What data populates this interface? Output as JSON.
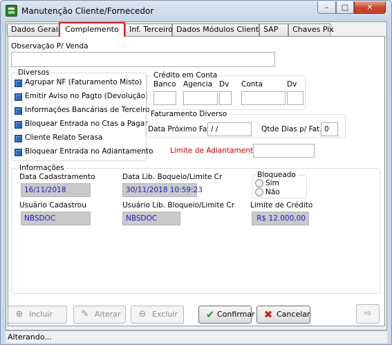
{
  "window": {
    "title": "Manutenção Cliente/Fornecedor",
    "minimize": "–",
    "maximize": "□",
    "close": "✕"
  },
  "tabs": [
    {
      "label": "Dados Gerais",
      "active": false
    },
    {
      "label": "Complemento",
      "active": true
    },
    {
      "label": "Inf. Terceiro",
      "active": false
    },
    {
      "label": "Dados Módulos Clientes",
      "active": false
    },
    {
      "label": "SAP",
      "active": false
    },
    {
      "label": "Chaves Pix",
      "active": false
    }
  ],
  "observacao": {
    "label": "Observação P/ Venda",
    "value": ""
  },
  "diversos": {
    "title": "Diversos",
    "items": [
      {
        "label": "Agrupar NF (Faturamento Misto)",
        "checked": false
      },
      {
        "label": "Emitir Aviso no Pagto (Devolução)",
        "checked": false
      },
      {
        "label": "Informações Bancárias de Terceiro",
        "checked": false
      },
      {
        "label": "Bloquear Entrada no Ctas a Pagar",
        "checked": false
      },
      {
        "label": "Cliente Relato Serasa",
        "checked": false
      },
      {
        "label": "Bloquear Entrada no Adiantamento",
        "checked": false
      }
    ]
  },
  "credito": {
    "title": "Crédito em Conta",
    "banco": "Banco",
    "agencia": "Agencia",
    "dv": "Dv",
    "conta": "Conta",
    "dv2": "Dv"
  },
  "faturamento": {
    "title": "Faturamento Diverso",
    "data_label": "Data Próximo Fat.",
    "data_value": " /  /",
    "qtde_label": "Qtde Dias p/ Fat.",
    "qtde_value": "0"
  },
  "limite_adiantamento": {
    "label": "Limite de Adiantamento",
    "value": "",
    "color": "#cc0000"
  },
  "informacoes": {
    "title": "Informações",
    "data_cadastramento_label": "Data Cadastramento",
    "data_cadastramento": "16/11/2018",
    "data_lib_label": "Data Lib. Boqueio/Limite Cr",
    "data_lib": "30/11/2018 10:59:23",
    "usuario_cadastrou_label": "Usuário Cadastrou",
    "usuario_cadastrou": "NBSDOC",
    "usuario_lib_label": "Usuário Lib. Bloqueio/Limite Cr",
    "usuario_lib": "NBSDOC",
    "limite_credito_label": "Limite de Crédito",
    "limite_credito": "R$ 12.000,00",
    "bloqueado": {
      "title": "Bloqueado",
      "options": [
        "Sim",
        "Não"
      ],
      "selected": null
    }
  },
  "buttons": {
    "incluir": "Incluir",
    "alterar": "Alterar",
    "excluir": "Excluir",
    "confirmar": "Confirmar",
    "cancelar": "Cancelar"
  },
  "status": "Alterando..."
}
